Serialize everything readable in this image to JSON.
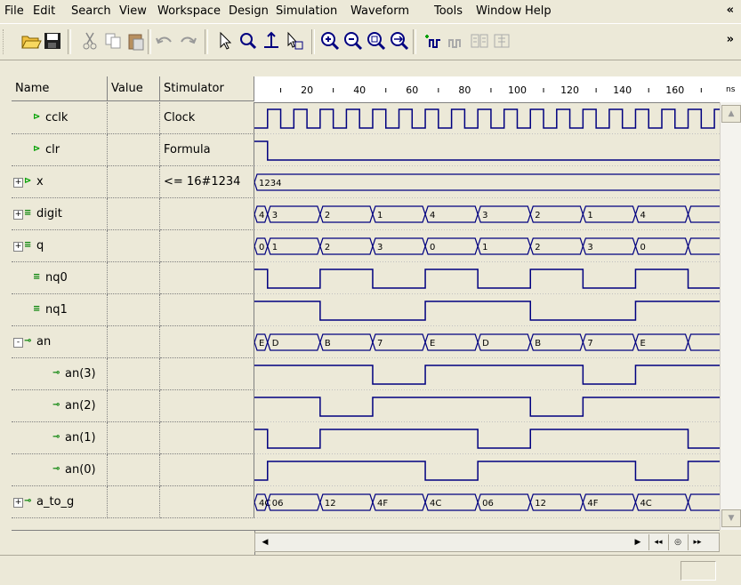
{
  "menu": {
    "items": [
      {
        "label": "File"
      },
      {
        "label": "Edit"
      },
      {
        "label": "Search"
      },
      {
        "label": "View"
      },
      {
        "label": "Workspace"
      },
      {
        "label": "Design"
      },
      {
        "label": "Simulation"
      },
      {
        "label": "Waveform"
      },
      {
        "label": "Tools"
      },
      {
        "label": "Window"
      },
      {
        "label": "Help"
      }
    ],
    "overflow": "«"
  },
  "toolbar": {
    "buttons": [
      {
        "name": "open-folder-icon"
      },
      {
        "name": "save-icon"
      },
      {
        "name": "cut-icon"
      },
      {
        "name": "copy-icon"
      },
      {
        "name": "paste-icon"
      },
      {
        "name": "undo-icon"
      },
      {
        "name": "redo-icon"
      },
      {
        "name": "select-pointer-icon"
      },
      {
        "name": "zoom-mode-icon"
      },
      {
        "name": "measure-icon"
      },
      {
        "name": "pan-icon"
      },
      {
        "name": "zoom-in-icon"
      },
      {
        "name": "zoom-out-icon"
      },
      {
        "name": "zoom-range-icon"
      },
      {
        "name": "zoom-fit-icon"
      },
      {
        "name": "add-signal-icon"
      },
      {
        "name": "remove-signal-icon"
      },
      {
        "name": "merge-icon"
      },
      {
        "name": "split-icon"
      }
    ],
    "overflow": "»"
  },
  "columns": {
    "name": "Name",
    "value": "Value",
    "stimulator": "Stimulator",
    "unit": "ns"
  },
  "ruler_ticks": [
    "20",
    "40",
    "60",
    "80",
    "100",
    "120",
    "140",
    "160"
  ],
  "signals": [
    {
      "name": "cclk",
      "stim": "Clock",
      "value": "",
      "type": "input",
      "expander": "",
      "indent": 1
    },
    {
      "name": "clr",
      "stim": "Formula",
      "value": "",
      "type": "input",
      "expander": "",
      "indent": 1
    },
    {
      "name": "x",
      "stim": "<= 16#1234",
      "value": "",
      "type": "input",
      "expander": "+",
      "indent": 0
    },
    {
      "name": "digit",
      "stim": "",
      "value": "",
      "type": "internal",
      "expander": "+",
      "indent": 0
    },
    {
      "name": "q",
      "stim": "",
      "value": "",
      "type": "internal",
      "expander": "+",
      "indent": 0
    },
    {
      "name": "nq0",
      "stim": "",
      "value": "",
      "type": "internal",
      "expander": "",
      "indent": 1
    },
    {
      "name": "nq1",
      "stim": "",
      "value": "",
      "type": "internal",
      "expander": "",
      "indent": 1
    },
    {
      "name": "an",
      "stim": "",
      "value": "",
      "type": "output",
      "expander": "-",
      "indent": 0
    },
    {
      "name": "an(3)",
      "stim": "",
      "value": "",
      "type": "output",
      "expander": "",
      "indent": 2
    },
    {
      "name": "an(2)",
      "stim": "",
      "value": "",
      "type": "output",
      "expander": "",
      "indent": 2
    },
    {
      "name": "an(1)",
      "stim": "",
      "value": "",
      "type": "output",
      "expander": "",
      "indent": 2
    },
    {
      "name": "an(0)",
      "stim": "",
      "value": "",
      "type": "output",
      "expander": "",
      "indent": 2
    },
    {
      "name": "a_to_g",
      "stim": "",
      "value": "",
      "type": "output",
      "expander": "+",
      "indent": 0
    }
  ],
  "waveforms": {
    "time_range": [
      0,
      177
    ],
    "cclk": {
      "period": 10,
      "start_low": true
    },
    "clr": {
      "high_until": 5
    },
    "x": {
      "bus": [
        [
          "1234",
          0
        ]
      ]
    },
    "digit": {
      "bus": [
        [
          "4",
          0
        ],
        [
          "3",
          5
        ],
        [
          "2",
          25
        ],
        [
          "1",
          45
        ],
        [
          "4",
          65
        ],
        [
          "3",
          85
        ],
        [
          "2",
          105
        ],
        [
          "1",
          125
        ],
        [
          "4",
          145
        ],
        [
          "",
          165
        ]
      ]
    },
    "q": {
      "bus": [
        [
          "0",
          0
        ],
        [
          "1",
          5
        ],
        [
          "2",
          25
        ],
        [
          "3",
          45
        ],
        [
          "0",
          65
        ],
        [
          "1",
          85
        ],
        [
          "2",
          105
        ],
        [
          "3",
          125
        ],
        [
          "0",
          145
        ],
        [
          "",
          165
        ]
      ]
    },
    "nq0": {
      "edges": [
        [
          0,
          1
        ],
        [
          5,
          0
        ],
        [
          25,
          1
        ],
        [
          45,
          0
        ],
        [
          65,
          1
        ],
        [
          85,
          0
        ],
        [
          105,
          1
        ],
        [
          125,
          0
        ],
        [
          145,
          1
        ],
        [
          165,
          0
        ]
      ]
    },
    "nq1": {
      "edges": [
        [
          0,
          1
        ],
        [
          25,
          0
        ],
        [
          65,
          1
        ],
        [
          105,
          0
        ],
        [
          145,
          1
        ]
      ]
    },
    "an": {
      "bus": [
        [
          "E",
          0
        ],
        [
          "D",
          5
        ],
        [
          "B",
          25
        ],
        [
          "7",
          45
        ],
        [
          "E",
          65
        ],
        [
          "D",
          85
        ],
        [
          "B",
          105
        ],
        [
          "7",
          125
        ],
        [
          "E",
          145
        ],
        [
          "",
          165
        ]
      ]
    },
    "an3": {
      "edges": [
        [
          0,
          1
        ],
        [
          45,
          0
        ],
        [
          65,
          1
        ],
        [
          125,
          0
        ],
        [
          145,
          1
        ]
      ]
    },
    "an2": {
      "edges": [
        [
          0,
          1
        ],
        [
          25,
          0
        ],
        [
          45,
          1
        ],
        [
          105,
          0
        ],
        [
          125,
          1
        ]
      ]
    },
    "an1": {
      "edges": [
        [
          0,
          1
        ],
        [
          5,
          0
        ],
        [
          25,
          1
        ],
        [
          85,
          0
        ],
        [
          105,
          1
        ],
        [
          165,
          0
        ]
      ]
    },
    "an0": {
      "edges": [
        [
          0,
          0
        ],
        [
          5,
          1
        ],
        [
          65,
          0
        ],
        [
          85,
          1
        ],
        [
          145,
          0
        ],
        [
          165,
          1
        ]
      ]
    },
    "a_to_g": {
      "bus": [
        [
          "4C",
          0
        ],
        [
          "06",
          5
        ],
        [
          "12",
          25
        ],
        [
          "4F",
          45
        ],
        [
          "4C",
          65
        ],
        [
          "06",
          85
        ],
        [
          "12",
          105
        ],
        [
          "4F",
          125
        ],
        [
          "4C",
          145
        ],
        [
          "",
          165
        ]
      ]
    }
  },
  "colors": {
    "wave": "#000080",
    "input_icon": "#00a000",
    "bg": "#ece9d8"
  }
}
